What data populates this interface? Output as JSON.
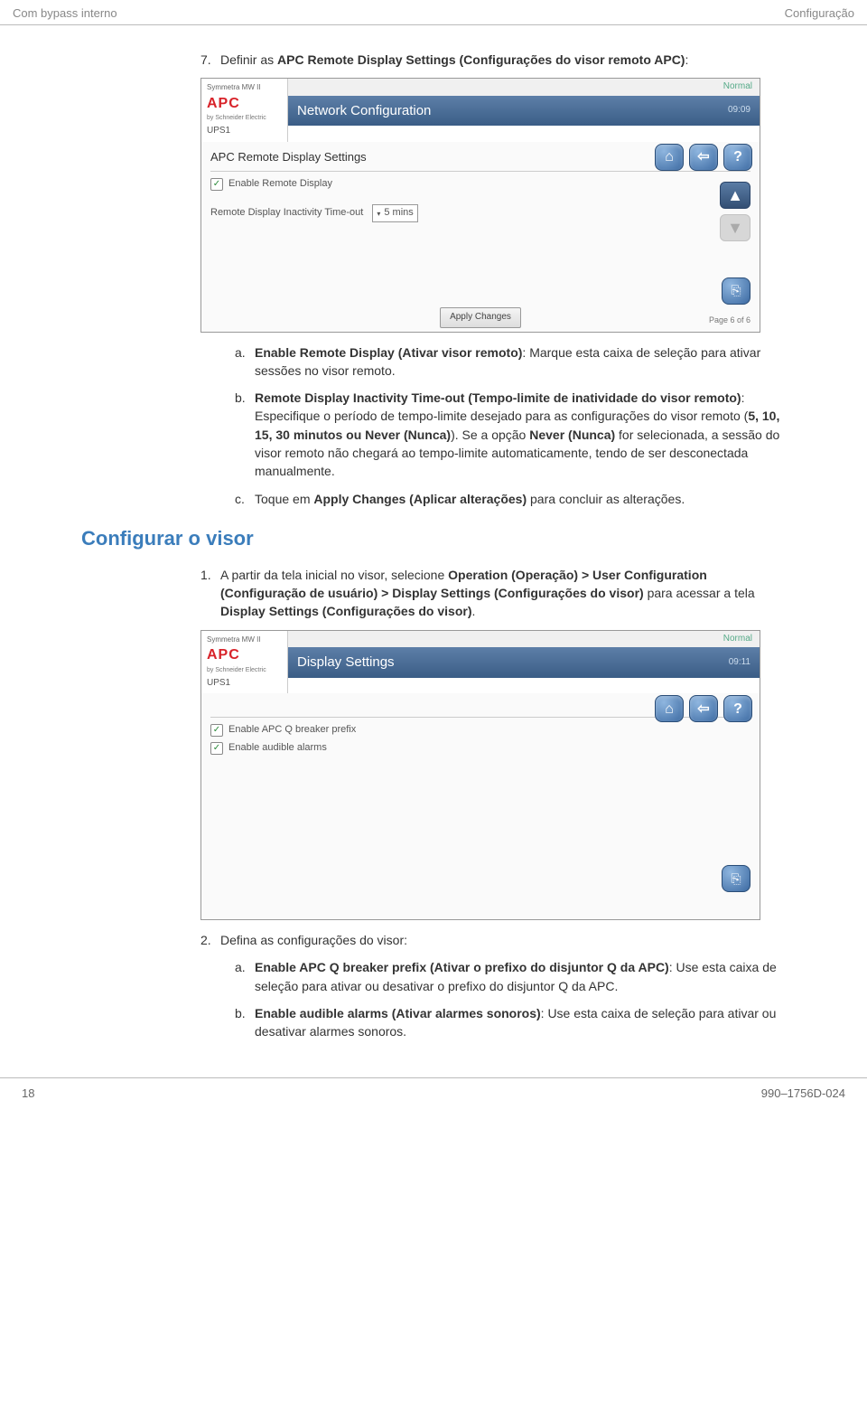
{
  "header": {
    "left": "Com bypass interno",
    "right": "Configuração"
  },
  "section7": {
    "marker": "7.",
    "intro_pre": "Definir as ",
    "intro_bold": "APC Remote Display Settings (Configurações do visor remoto APC)",
    "intro_post": ":"
  },
  "shot1": {
    "brand_top": "Symmetra MW II",
    "brand_apc": "APC",
    "brand_sub": "by Schneider Electric",
    "ups": "UPS1",
    "status": "Normal",
    "title": "Network Configuration",
    "time": "09:09",
    "section_title": "APC Remote Display Settings",
    "chk_label": "Enable Remote Display",
    "field_label": "Remote Display Inactivity Time-out",
    "dd_value": "5 mins",
    "apply": "Apply Changes",
    "page_ind": "Page 6 of 6"
  },
  "sub_a": {
    "marker": "a.",
    "pre": "",
    "bold": "Enable Remote Display (Ativar visor remoto)",
    "post": ": Marque esta caixa de seleção para ativar sessões no visor remoto."
  },
  "sub_b": {
    "marker": "b.",
    "pre": "",
    "bold": "Remote Display Inactivity Time-out (Tempo-limite de inatividade do visor remoto)",
    "post": ": Especifique o período de tempo-limite desejado para as configurações do visor remoto (",
    "bold2": "5, 10, 15, 30 minutos ou Never (Nunca)",
    "post2": "). Se a opção ",
    "bold3": "Never (Nunca)",
    "post3": " for selecionada, a sessão do visor remoto não chegará ao tempo-limite automaticamente, tendo de ser desconectada manualmente."
  },
  "sub_c": {
    "marker": "c.",
    "pre": "Toque em ",
    "bold": "Apply Changes (Aplicar alterações)",
    "post": " para concluir as alterações."
  },
  "h2": "Configurar o visor",
  "step1": {
    "marker": "1.",
    "pre": "A partir da tela inicial no visor, selecione ",
    "bold1": "Operation (Operação) > User Configuration (Configuração de usuário) > Display Settings (Configurações do visor)",
    "mid": " para acessar a tela ",
    "bold2": "Display Settings (Configurações do visor)",
    "post": "."
  },
  "shot2": {
    "brand_top": "Symmetra MW II",
    "brand_apc": "APC",
    "brand_sub": "by Schneider Electric",
    "ups": "UPS1",
    "status": "Normal",
    "title": "Display Settings",
    "time": "09:11",
    "chk1": "Enable APC Q breaker prefix",
    "chk2": "Enable audible alarms"
  },
  "step2": {
    "marker": "2.",
    "text": "Defina as configurações do visor:"
  },
  "sub2_a": {
    "marker": "a.",
    "bold": "Enable APC Q breaker prefix (Ativar o prefixo do disjuntor Q da APC)",
    "post": ": Use esta caixa de seleção para ativar ou desativar o prefixo do disjuntor Q da APC."
  },
  "sub2_b": {
    "marker": "b.",
    "bold": "Enable audible alarms (Ativar alarmes sonoros)",
    "post": ": Use esta caixa de seleção para ativar ou desativar alarmes sonoros."
  },
  "footer": {
    "left": "18",
    "right": "990–1756D-024"
  }
}
